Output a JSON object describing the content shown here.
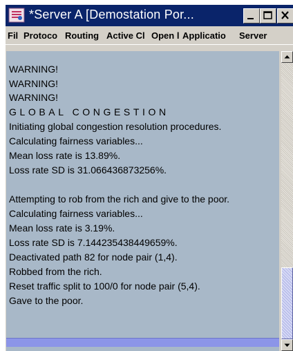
{
  "window": {
    "title": "*Server A   [Demostation Por...",
    "colors": {
      "titlebar": "#0a246a",
      "content_bg": "#a8b8c8",
      "scroll_thumb": "#c4c8f0"
    }
  },
  "menu": {
    "items": [
      "Fil",
      "Protoco",
      "Routing",
      "Active Cl",
      "Open l",
      "Applicatio",
      "Server"
    ]
  },
  "log": {
    "lines": [
      "WARNING!",
      "WARNING!",
      "WARNING!",
      "GLOBAL CONGESTION",
      "Initiating global congestion resolution procedures.",
      "Calculating fairness variables...",
      "Mean loss rate is 13.89%.",
      "Loss rate SD is 31.066436873256%.",
      "",
      "Attempting to rob from the rich and give to the poor.",
      "Calculating fairness variables...",
      "Mean loss rate is 3.19%.",
      "Loss rate SD is 7.144235438449659%.",
      "Deactivated path 82 for node pair (1,4).",
      "Robbed from the rich.",
      "Reset traffic split to 100/0 for node pair (5,4).",
      "Gave to the poor."
    ]
  },
  "icons": {
    "app": "java-app-icon",
    "minimize": "minimize-icon",
    "maximize": "maximize-icon",
    "close": "close-icon",
    "scroll_up": "arrow-up-icon",
    "scroll_down": "arrow-down-icon"
  }
}
